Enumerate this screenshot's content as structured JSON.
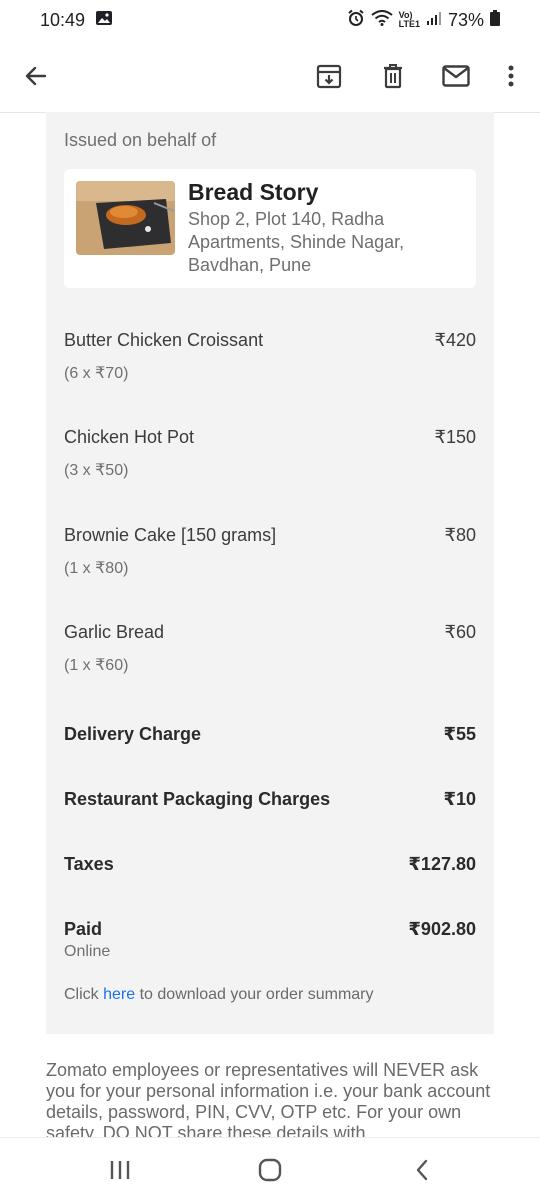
{
  "status_bar": {
    "time": "10:49",
    "battery": "73%",
    "icons": [
      "gallery-icon",
      "alarm-icon",
      "wifi-icon",
      "volte-icon",
      "signal-icon",
      "battery-icon"
    ]
  },
  "toolbar": {
    "icons": [
      "back-arrow-icon",
      "archive-icon",
      "delete-icon",
      "mail-icon",
      "more-vert-icon"
    ]
  },
  "receipt": {
    "issued_label": "Issued on behalf of",
    "restaurant": {
      "name": "Bread Story",
      "address": "Shop 2, Plot 140, Radha Apartments, Shinde Nagar, Bavdhan, Pune"
    },
    "items": [
      {
        "name": "Butter Chicken Croissant",
        "qty": "(6 x ₹70)",
        "price": "₹420"
      },
      {
        "name": "Chicken Hot Pot",
        "qty": "(3 x ₹50)",
        "price": "₹150"
      },
      {
        "name": "Brownie Cake [150 grams]",
        "qty": "(1 x ₹80)",
        "price": "₹80"
      },
      {
        "name": "Garlic Bread",
        "qty": "(1 x ₹60)",
        "price": "₹60"
      }
    ],
    "delivery": {
      "label": "Delivery Charge",
      "value": "₹55"
    },
    "packaging": {
      "label": "Restaurant Packaging Charges",
      "value": "₹10"
    },
    "taxes": {
      "label": "Taxes",
      "value": "₹127.80"
    },
    "paid": {
      "label": "Paid",
      "sub": "Online",
      "value": "₹902.80"
    },
    "summary": {
      "prefix": "Click",
      "link": "here",
      "suffix": "to download your order summary"
    }
  },
  "disclaimer": "Zomato employees or representatives will NEVER ask you for your personal information i.e. your bank account details, password, PIN, CVV, OTP etc. For your own safety, DO NOT share these details with",
  "nav_bar": {
    "icons": [
      "recent-apps-icon",
      "home-icon",
      "back-icon"
    ]
  }
}
